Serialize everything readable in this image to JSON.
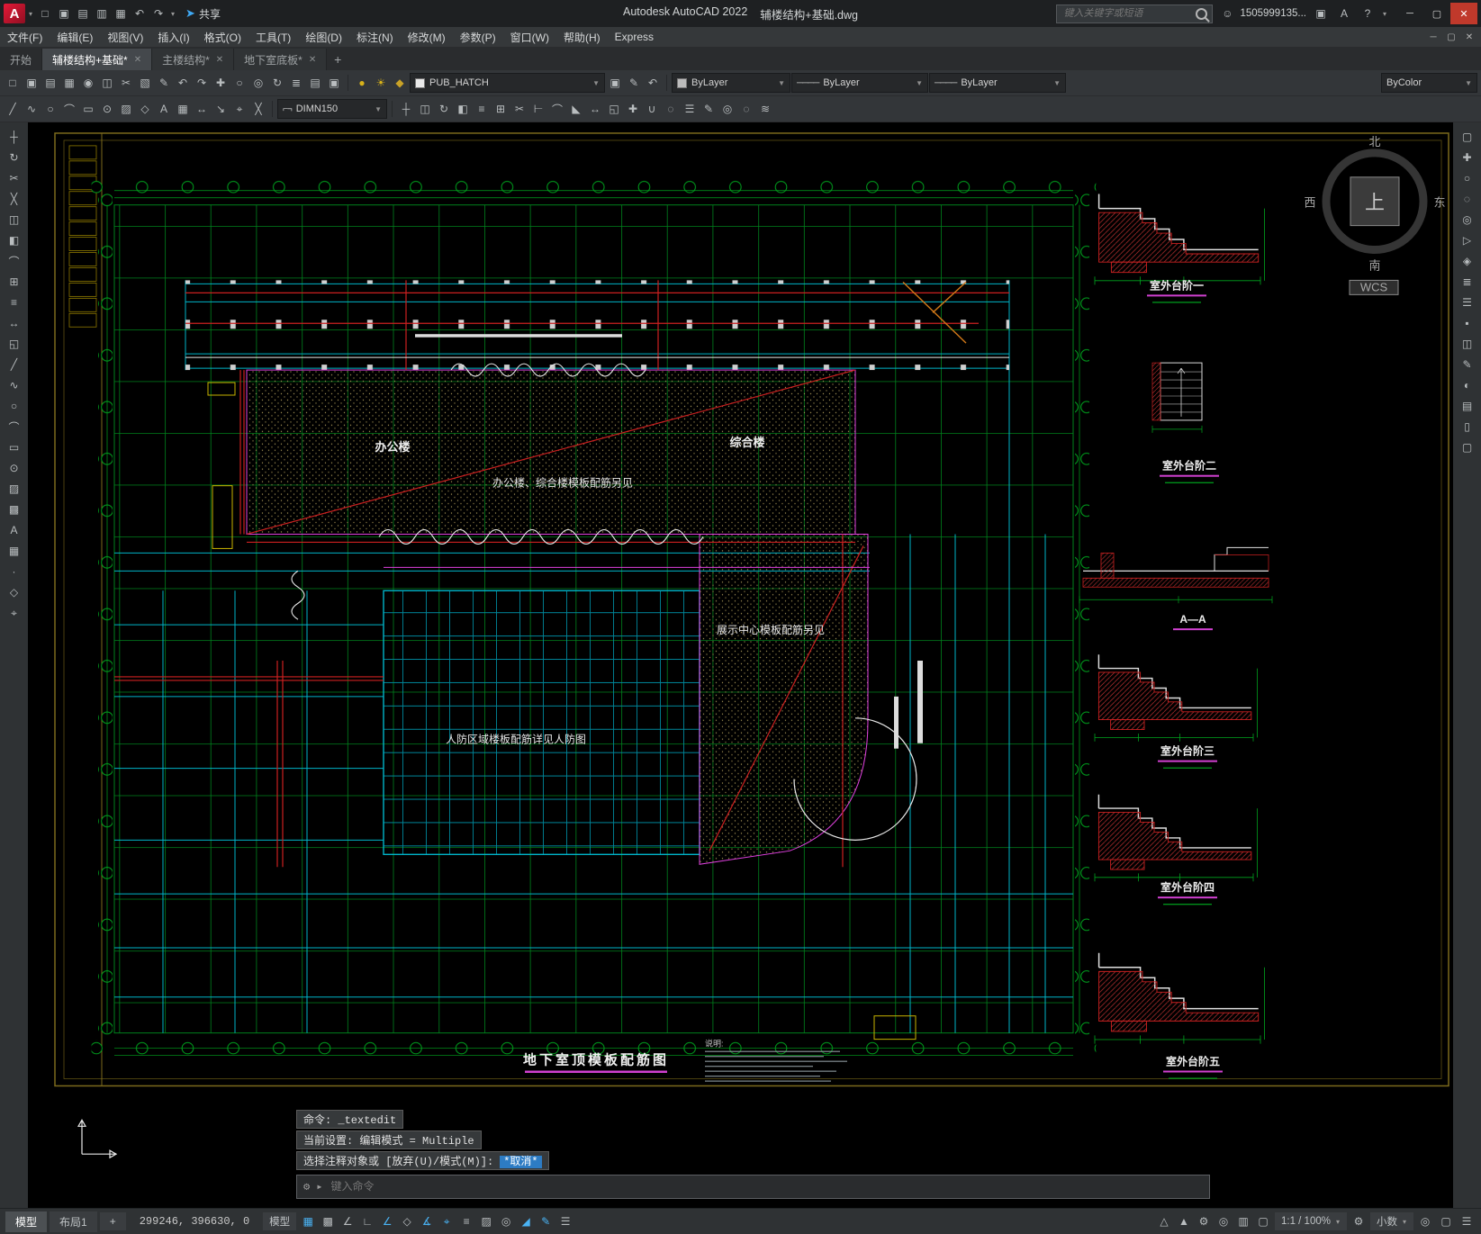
{
  "titlebar": {
    "share": "共享",
    "app_title": "Autodesk AutoCAD 2022",
    "doc_title": "辅楼结构+基础.dwg",
    "search_placeholder": "键入关键字或短语",
    "user": "1505999135...",
    "quick_icons": [
      "new",
      "open",
      "save",
      "save-as",
      "plot",
      "undo",
      "redo"
    ]
  },
  "menubar": {
    "items": [
      "文件(F)",
      "编辑(E)",
      "视图(V)",
      "插入(I)",
      "格式(O)",
      "工具(T)",
      "绘图(D)",
      "标注(N)",
      "修改(M)",
      "参数(P)",
      "窗口(W)",
      "帮助(H)",
      "Express"
    ]
  },
  "doc_tabs": {
    "items": [
      {
        "label": "开始",
        "active": false
      },
      {
        "label": "辅楼结构+基础*",
        "active": true
      },
      {
        "label": "主楼结构*",
        "active": false
      },
      {
        "label": "地下室底板*",
        "active": false
      }
    ],
    "new_tab": "+"
  },
  "ribbon": {
    "row1_icons": [
      "new",
      "open",
      "save",
      "plot",
      "preview",
      "copy",
      "cut",
      "paste",
      "match",
      "undo",
      "redo",
      "pan",
      "zoom",
      "extents",
      "regen",
      "layers",
      "layer-states",
      "make-current"
    ],
    "layer_tool_icons": [
      "bulb",
      "sun",
      "lock"
    ],
    "layer_combo": "PUB_HATCH",
    "layer_after_icons": [
      "make-current",
      "match-layer",
      "layer-previous"
    ],
    "color_combo": "ByLayer",
    "linetype_combo": "ByLayer",
    "lineweight_combo": "ByLayer",
    "plotstyle_combo": "ByColor",
    "row2_icons_a": [
      "line",
      "polyline",
      "circle",
      "arc",
      "rectangle",
      "ellipse",
      "hatch",
      "block",
      "text",
      "table",
      "dimension",
      "leader",
      "measure",
      "erase"
    ],
    "dimstyle_combo": "DIMN150",
    "row2_icons_b": [
      "move",
      "copy2",
      "rotate",
      "mirror",
      "offset",
      "array",
      "trim",
      "extend",
      "fillet",
      "chamfer",
      "stretch",
      "scale",
      "explode",
      "join",
      "group",
      "properties",
      "match2",
      "isolate",
      "hide",
      "overkill"
    ]
  },
  "palettes": {
    "left_icons": [
      "move",
      "rotate",
      "trim",
      "erase",
      "copy2",
      "mirror",
      "fillet",
      "array",
      "offset",
      "stretch",
      "scale",
      "line",
      "polyline",
      "circle",
      "arc",
      "rectangle",
      "ellipse",
      "hatch",
      "gradient",
      "text",
      "table",
      "point",
      "block",
      "measure"
    ],
    "right_icons": [
      "fullscreen",
      "pan",
      "zoom",
      "orbit",
      "wheel",
      "show-motion",
      "map",
      "layers",
      "properties",
      "blocks",
      "xref",
      "markup",
      "render",
      "sheet-set",
      "tool-palettes",
      "clean"
    ]
  },
  "viewcube": {
    "north": "北",
    "south": "南",
    "west": "西",
    "east": "东",
    "up": "上",
    "wcs": "WCS"
  },
  "plan": {
    "label_office": "办公楼",
    "label_complex": "综合楼",
    "note_office": "办公楼、综合楼模板配筋另见",
    "note_exhibit": "展示中心模板配筋另见",
    "note_civil": "人防区域楼板配筋详见人防图",
    "drawing_title": "地下室顶模板配筋图",
    "notes_heading": "说明:",
    "details": [
      "室外台阶一",
      "室外台阶二",
      "A—A",
      "室外台阶三",
      "室外台阶四",
      "室外台阶五"
    ]
  },
  "command": {
    "history": [
      "命令: _textedit",
      "当前设置: 编辑模式 = Multiple",
      "选择注释对象或 [放弃(U)/模式(M)]:"
    ],
    "cancel": "*取消*",
    "prompt_placeholder": "键入命令"
  },
  "statusbar": {
    "model_tab": "模型",
    "layout_tab": "布局1",
    "new_layout": "+",
    "coords": "299246, 396630, 0",
    "model_space": "模型",
    "toggles": [
      {
        "name": "grid",
        "active": true
      },
      {
        "name": "snap",
        "active": false
      },
      {
        "name": "infer",
        "active": false
      },
      {
        "name": "ortho",
        "active": false
      },
      {
        "name": "polar",
        "active": true
      },
      {
        "name": "isodraft",
        "active": false
      },
      {
        "name": "otrack",
        "active": true
      },
      {
        "name": "osnap",
        "active": true
      },
      {
        "name": "lineweight",
        "active": false
      },
      {
        "name": "transparency",
        "active": false
      },
      {
        "name": "cycling",
        "active": false
      },
      {
        "name": "dynamic-ucs",
        "active": true
      },
      {
        "name": "dynamic-input",
        "active": true
      },
      {
        "name": "quick-properties",
        "active": false
      }
    ],
    "scale": "1:1 / 100%",
    "units": "小数",
    "right_icons": [
      "annotation-visibility",
      "autoscale",
      "workspace",
      "isolate",
      "graphics",
      "clean-screen"
    ]
  }
}
